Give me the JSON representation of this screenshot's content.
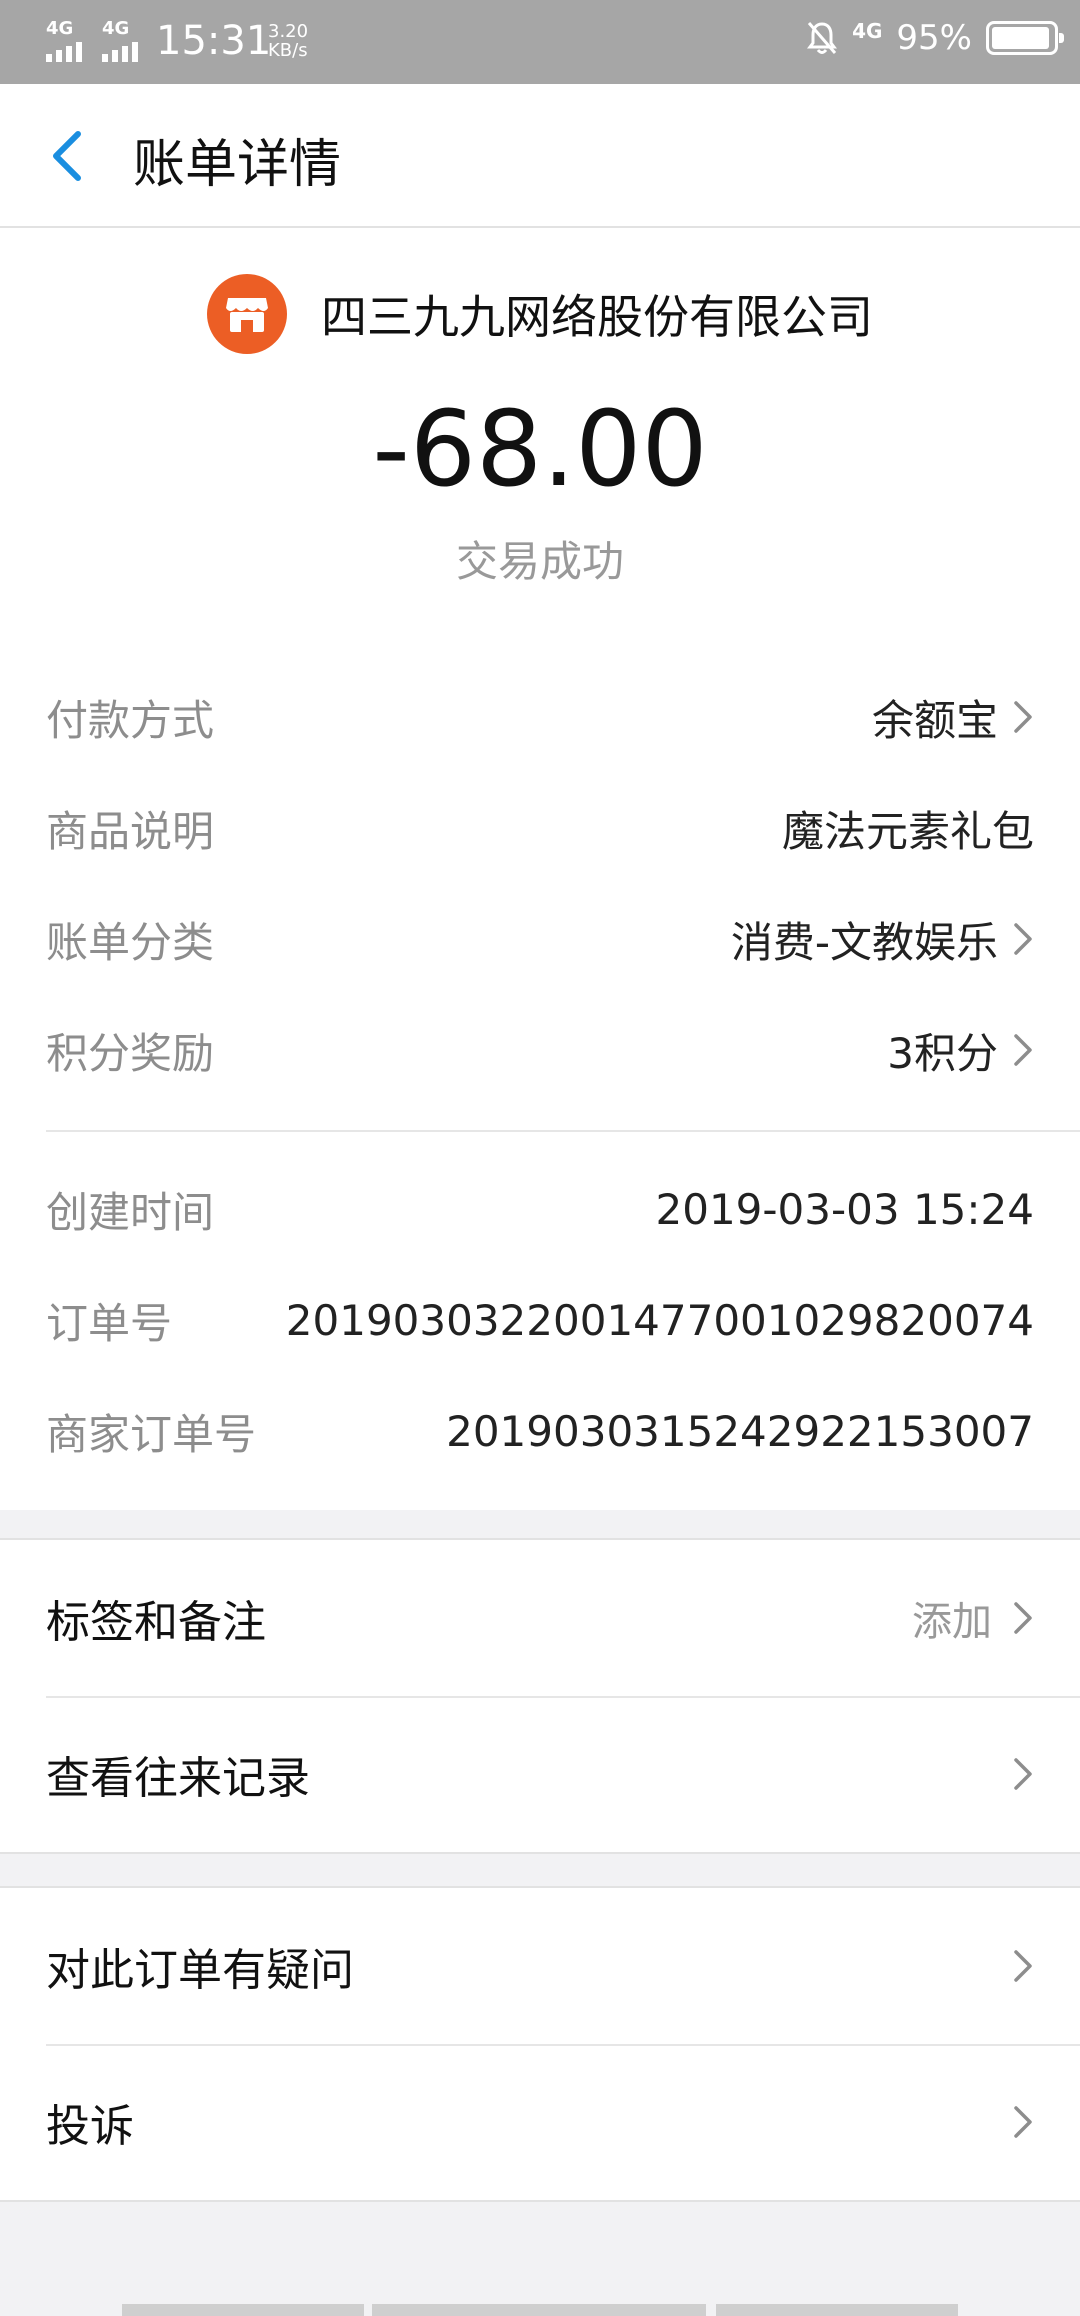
{
  "status_bar": {
    "network1": "4G",
    "network2": "4G",
    "time": "15:31",
    "speed_value": "3.20",
    "speed_unit": "KB/s",
    "network3": "4G",
    "battery_text": "95%",
    "battery_level": 0.95
  },
  "header": {
    "title": "账单详情"
  },
  "summary": {
    "merchant": "四三九九网络股份有限公司",
    "amount": "-68.00",
    "status": "交易成功",
    "accent_color": "#ec5e25"
  },
  "details_top": [
    {
      "label": "付款方式",
      "value": "余额宝"
    },
    {
      "label": "商品说明",
      "value": "魔法元素礼包"
    },
    {
      "label": "账单分类",
      "value": "消费-文教娱乐"
    },
    {
      "label": "积分奖励",
      "value": "3积分"
    }
  ],
  "details_bottom": [
    {
      "label": "创建时间",
      "value": "2019-03-03 15:24"
    },
    {
      "label": "订单号",
      "value": "2019030322001477001029820074"
    },
    {
      "label": "商家订单号",
      "value": "20190303152429221530​07"
    }
  ],
  "actions1": [
    {
      "label": "标签和备注",
      "action": "添加"
    },
    {
      "label": "查看往来记录"
    }
  ],
  "actions2": [
    {
      "label": "对此订单有疑问"
    },
    {
      "label": "投诉"
    }
  ],
  "colors": {
    "link_blue": "#1a8ee0",
    "muted": "#8d8d8d"
  }
}
